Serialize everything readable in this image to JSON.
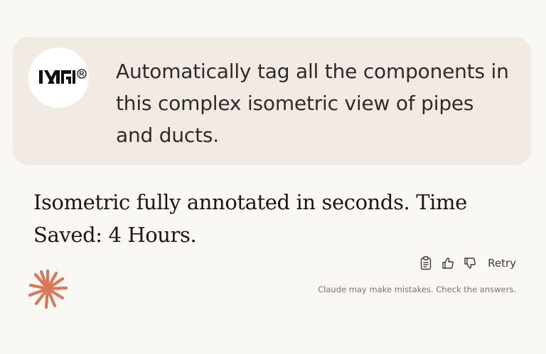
{
  "user_message": {
    "avatar_icon": "brand-logo-icon",
    "text": "Automatically tag all the components in this complex isometric view of pipes and ducts."
  },
  "assistant_message": {
    "text": "Isometric fully annotated in seconds. Time Saved: 4 Hours."
  },
  "message_actions": {
    "copy_icon": "clipboard-icon",
    "thumbs_up_icon": "thumbs-up-icon",
    "thumbs_down_icon": "thumbs-down-icon",
    "retry_label": "Retry"
  },
  "footer": {
    "disclaimer": "Claude may make mistakes. Check the answers.",
    "logo_icon": "claude-starburst-icon",
    "logo_color": "#d97757"
  }
}
